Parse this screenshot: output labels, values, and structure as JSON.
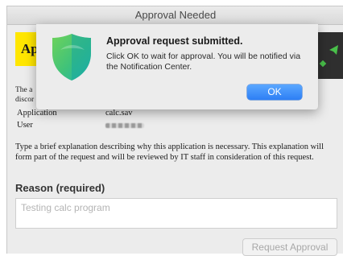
{
  "window": {
    "title": "Approval Needed"
  },
  "header": {
    "logo_text": "Ap"
  },
  "intro_text": [
    "The a",
    "discor"
  ],
  "details": {
    "application_label": "Application",
    "application_value": "calc.sav",
    "user_label": "User"
  },
  "explanation": "Type a brief explanation describing why this application is necessary. This explanation will form part of the request and will be reviewed by IT staff in consideration of this request.",
  "reason": {
    "label": "Reason (required)",
    "value": "Testing calc program"
  },
  "request_button": "Request Approval",
  "alert": {
    "title": "Approval request submitted.",
    "message": "Click OK to wait for approval. You will be notified via the Notification Center.",
    "ok_label": "OK",
    "icon": "shield-icon"
  },
  "colors": {
    "accent": "#2d7ff5",
    "logo_yellow": "#ffe600",
    "shield_green": "#3fc27a",
    "shield_teal": "#1fb5b0"
  }
}
